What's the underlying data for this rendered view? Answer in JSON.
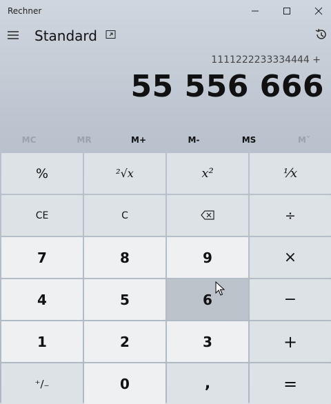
{
  "window": {
    "title": "Rechner",
    "minimize": "minimize-icon",
    "maximize": "maximize-icon",
    "close": "close-icon"
  },
  "header": {
    "mode_title": "Standard",
    "menu_icon": "hamburger-icon",
    "keep_on_top_icon": "keep-on-top-icon",
    "history_icon": "history-icon"
  },
  "display": {
    "expression": "1111222233334444 +",
    "result": "55 556 666"
  },
  "memory": [
    {
      "label": "MC",
      "enabled": false
    },
    {
      "label": "MR",
      "enabled": false
    },
    {
      "label": "M+",
      "enabled": true
    },
    {
      "label": "M-",
      "enabled": true
    },
    {
      "label": "MS",
      "enabled": true
    },
    {
      "label": "Mˇ",
      "enabled": false
    }
  ],
  "keys": {
    "percent": "%",
    "sqrt": "²√x",
    "square": "x²",
    "reciprocal": "⅟x",
    "ce": "CE",
    "c": "C",
    "backspace_icon": "backspace-icon",
    "divide": "÷",
    "seven": "7",
    "eight": "8",
    "nine": "9",
    "multiply": "×",
    "four": "4",
    "five": "5",
    "six": "6",
    "minus": "−",
    "one": "1",
    "two": "2",
    "three": "3",
    "plus": "+",
    "negate": "⁺∕₋",
    "zero": "0",
    "decimal": ",",
    "equals": "="
  },
  "colors": {
    "operator_key": "#dde2e7",
    "number_key": "#eef0f2",
    "hover_key": "#bcc3ca"
  }
}
